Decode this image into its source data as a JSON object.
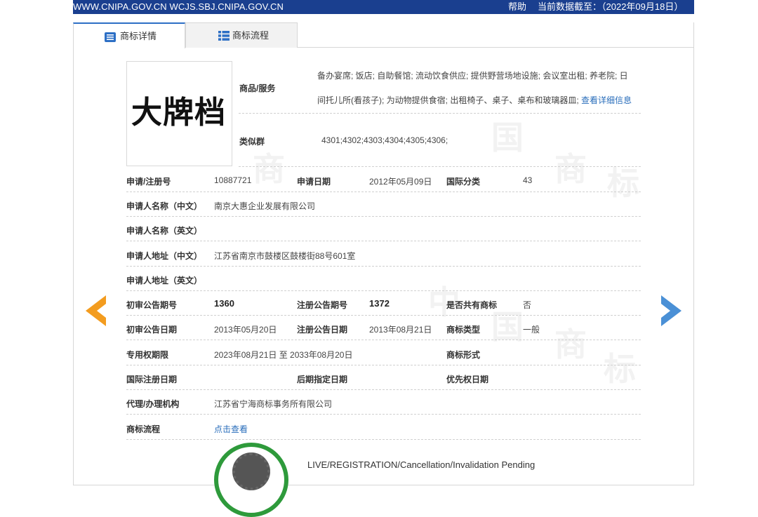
{
  "topbar": {
    "sites": "WWW.CNIPA.GOV.CN WCJS.SBJ.CNIPA.GOV.CN",
    "help": "帮助",
    "data_date": "当前数据截至：（2022年09月18日）",
    "color": "#1a3f8f"
  },
  "tabs": [
    {
      "label": "商标详情",
      "active": true,
      "icon": "list-detail-icon"
    },
    {
      "label": "商标流程",
      "active": false,
      "icon": "grid-list-icon"
    }
  ],
  "mark": {
    "image_text": "大牌档"
  },
  "goods": {
    "label": "商品/服务",
    "line1": "备办宴席; 饭店; 自助餐馆; 流动饮食供应; 提供野营场地设施; 会议室出租; 养老院; 日",
    "line2": "间托儿所(看孩子); 为动物提供食宿; 出租椅子、桌子、桌布和玻璃器皿;",
    "detail_link": "查看详细信息"
  },
  "similar_group": {
    "label": "类似群",
    "value": "4301;4302;4303;4304;4305;4306;"
  },
  "fields": {
    "app_no_label": "申请/注册号",
    "app_no": "10887721",
    "app_date_label": "申请日期",
    "app_date": "2012年05月09日",
    "intl_class_label": "国际分类",
    "intl_class": "43",
    "applicant_cn_label": "申请人名称（中文）",
    "applicant_cn": "南京大惠企业发展有限公司",
    "applicant_en_label": "申请人名称（英文）",
    "address_cn_label": "申请人地址（中文）",
    "address_cn": "江苏省南京市鼓楼区鼓楼街88号601室",
    "address_en_label": "申请人地址（英文）",
    "prelim_no_label": "初审公告期号",
    "prelim_no": "1360",
    "reg_no_label": "注册公告期号",
    "reg_no": "1372",
    "shared_label": "是否共有商标",
    "shared": "否",
    "prelim_date_label": "初审公告日期",
    "prelim_date": "2013年05月20日",
    "reg_date_label": "注册公告日期",
    "reg_date": "2013年08月21日",
    "mark_type_label": "商标类型",
    "mark_type": "一般",
    "exclusive_label": "专用权期限",
    "exclusive": "2023年08月21日 至 2033年08月20日",
    "mark_form_label": "商标形式",
    "intl_reg_date_label": "国际注册日期",
    "later_designation_label": "后期指定日期",
    "priority_date_label": "优先权日期",
    "agent_label": "代理/办理机构",
    "agent": "江苏省宁海商标事务所有限公司",
    "process_label": "商标流程",
    "process_link": "点击查看"
  },
  "status": {
    "text": "LIVE/REGISTRATION/Cancellation/Invalidation Pending",
    "ring_color": "#2e9a3b"
  },
  "nav": {
    "prev_icon": "arrow-left-icon",
    "next_icon": "arrow-right-icon",
    "prev_color": "#f39c1f",
    "next_color": "#4a90d6"
  }
}
